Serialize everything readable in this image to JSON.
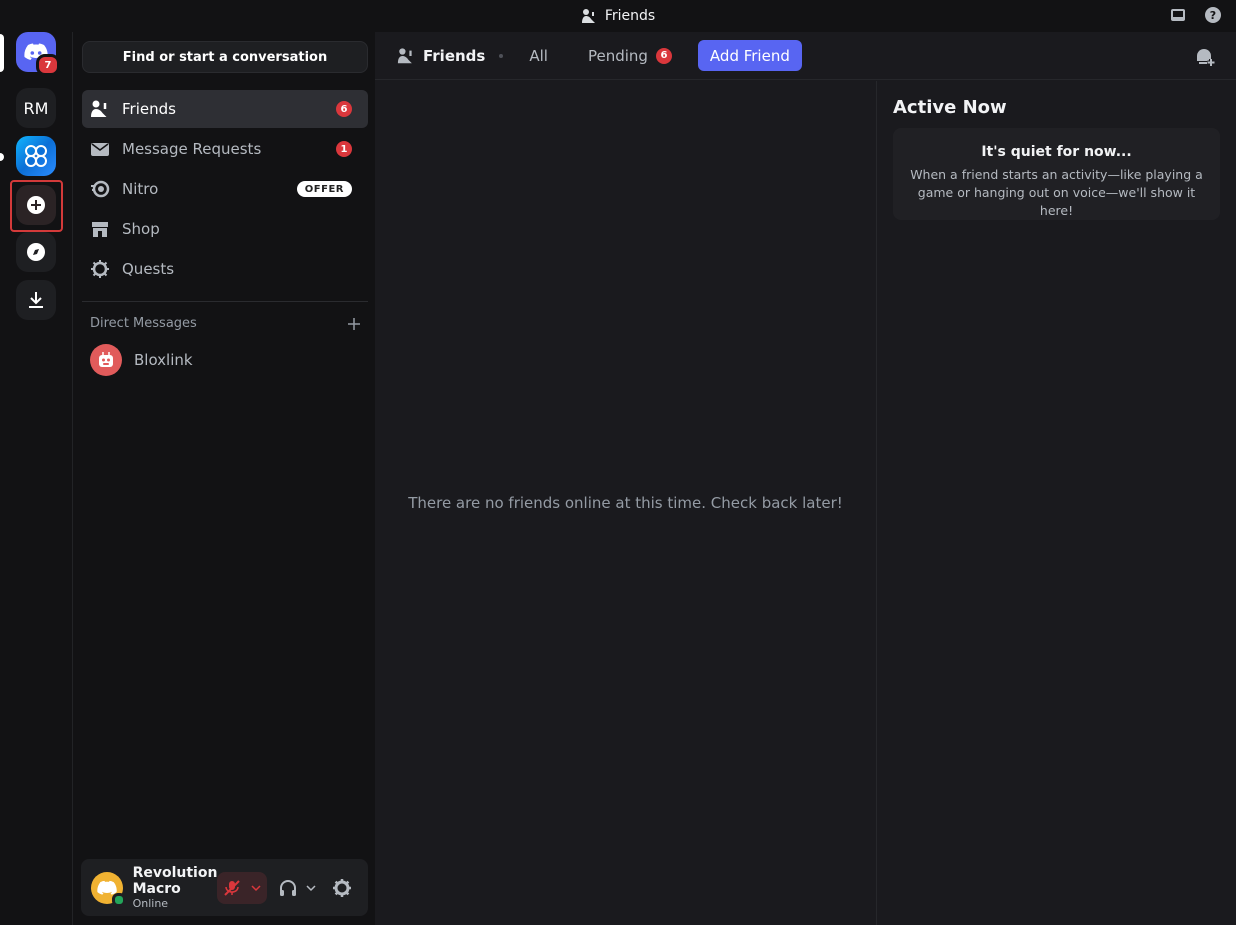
{
  "window": {
    "title": "Friends"
  },
  "rail": {
    "home_badge": "7",
    "server_initials": "RM"
  },
  "sidebar": {
    "search_label": "Find or start a conversation",
    "nav": [
      {
        "label": "Friends",
        "badge": "6"
      },
      {
        "label": "Message Requests",
        "badge": "1"
      },
      {
        "label": "Nitro",
        "tag": "OFFER"
      },
      {
        "label": "Shop"
      },
      {
        "label": "Quests"
      }
    ],
    "dm_header": "Direct Messages",
    "dms": [
      {
        "name": "Bloxlink"
      }
    ]
  },
  "user": {
    "name": "Revolution Macro",
    "status": "Online"
  },
  "topbar": {
    "title": "Friends",
    "tabs": [
      {
        "label": "All"
      },
      {
        "label": "Pending",
        "badge": "6"
      }
    ],
    "add_friend_label": "Add Friend"
  },
  "main": {
    "empty_message": "There are no friends online at this time. Check back later!"
  },
  "active_now": {
    "title": "Active Now",
    "card_title": "It's quiet for now...",
    "card_body": "When a friend starts an activity—like playing a game or hanging out on voice—we'll show it here!"
  },
  "colors": {
    "accent": "#5865f2",
    "danger": "#da373c",
    "online": "#23a55a"
  }
}
